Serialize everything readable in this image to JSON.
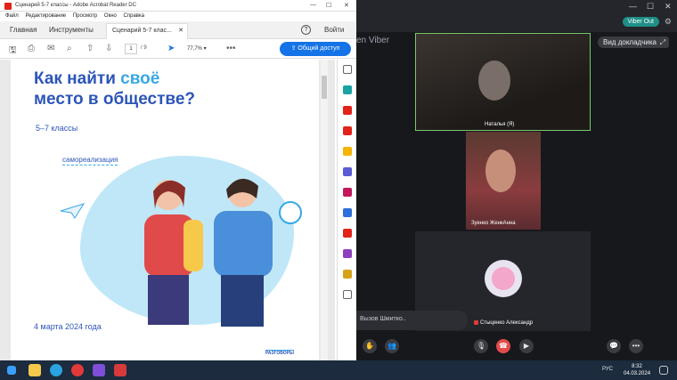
{
  "acrobat": {
    "window_title": "Сценарий 5-7 классы - Adobe Acrobat Reader DC",
    "menu": [
      "Файл",
      "Редактирование",
      "Просмотр",
      "Окно",
      "Справка"
    ],
    "tabs": {
      "home": "Главная",
      "tools": "Инструменты",
      "document": "Сценарий 5-7 клас..."
    },
    "login": "Войти",
    "help_glyph": "?",
    "page_current": "1",
    "page_total": "/ 9",
    "zoom": "77,7%",
    "share": "Общий доступ"
  },
  "document": {
    "title_part1": "Как найти ",
    "title_accent": "своё",
    "title_part2": "место в обществе?",
    "grades": "5–7 классы",
    "topic": "самореализация",
    "date": "4 марта 2024 года",
    "logo": "РАЗГОВОРЫ"
  },
  "viber": {
    "brand": "en Viber",
    "out_badge": "Viber Out",
    "view_button": "Вид докладчика",
    "participants": [
      {
        "name": "Наталья (Я)"
      },
      {
        "name": "Зуенко ЖенкАнна"
      },
      {
        "name": "Стыценко Александр"
      }
    ],
    "chat_input": "Вызов Шмитко.."
  },
  "taskbar": {
    "lang": "РУС",
    "time": "8:32",
    "date": "04.03.2024"
  },
  "colors": {
    "accent": "#1473e6",
    "doc_blue": "#2c55b8",
    "doc_light": "#37a8e6",
    "viber_green": "#1f8f86"
  }
}
